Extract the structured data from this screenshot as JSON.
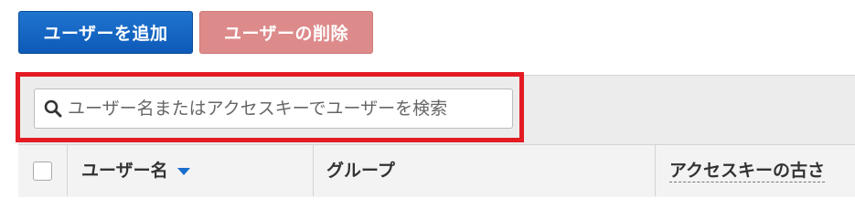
{
  "toolbar": {
    "add_user_label": "ユーザーを追加",
    "delete_user_label": "ユーザーの削除"
  },
  "search": {
    "placeholder": "ユーザー名またはアクセスキーでユーザーを検索",
    "value": "",
    "icon": "search-icon"
  },
  "table": {
    "columns": [
      {
        "label": "ユーザー名",
        "sort": "descending"
      },
      {
        "label": "グループ"
      },
      {
        "label": "アクセスキーの古さ"
      }
    ]
  },
  "colors": {
    "primary": "#0d5ab8",
    "danger_disabled": "#dd8a8a",
    "highlight": "#e31b23",
    "sort_caret": "#1a6ecc"
  }
}
